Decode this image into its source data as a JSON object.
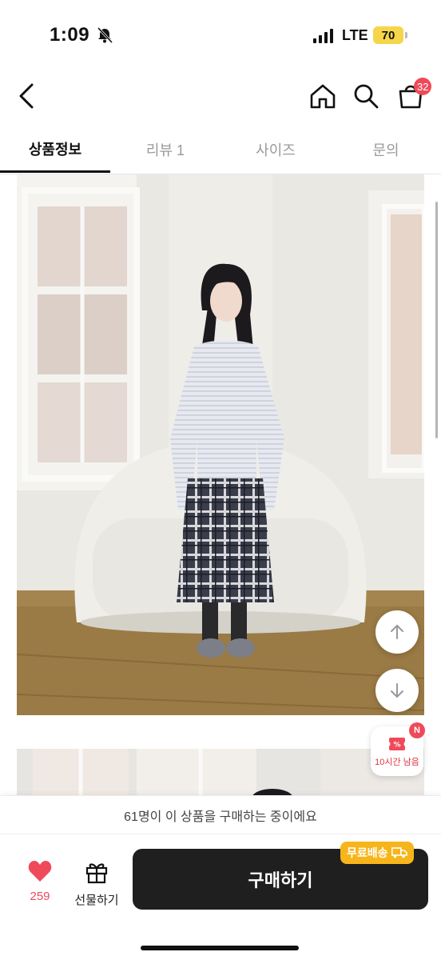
{
  "status_bar": {
    "time": "1:09",
    "network": "LTE",
    "battery": "70"
  },
  "header": {
    "cart_count": "32",
    "icons": [
      "back-icon",
      "home-icon",
      "search-icon",
      "cart-icon"
    ]
  },
  "tabs": [
    {
      "label": "상품정보",
      "active": true
    },
    {
      "label": "리뷰 1",
      "active": false
    },
    {
      "label": "사이즈",
      "active": false
    },
    {
      "label": "문의",
      "active": false
    }
  ],
  "coupon": {
    "badge": "N",
    "label": "10시간 남음"
  },
  "notice": "61명이 이 상품을 구매하는 중이에요",
  "actions": {
    "like_count": "259",
    "gift_label": "선물하기",
    "buy_label": "구매하기",
    "shipping_badge": "무료배송"
  },
  "colors": {
    "accent": "#ef4a5a",
    "buy_button": "#1f1f1f",
    "shipping_badge": "#f7b51c"
  }
}
